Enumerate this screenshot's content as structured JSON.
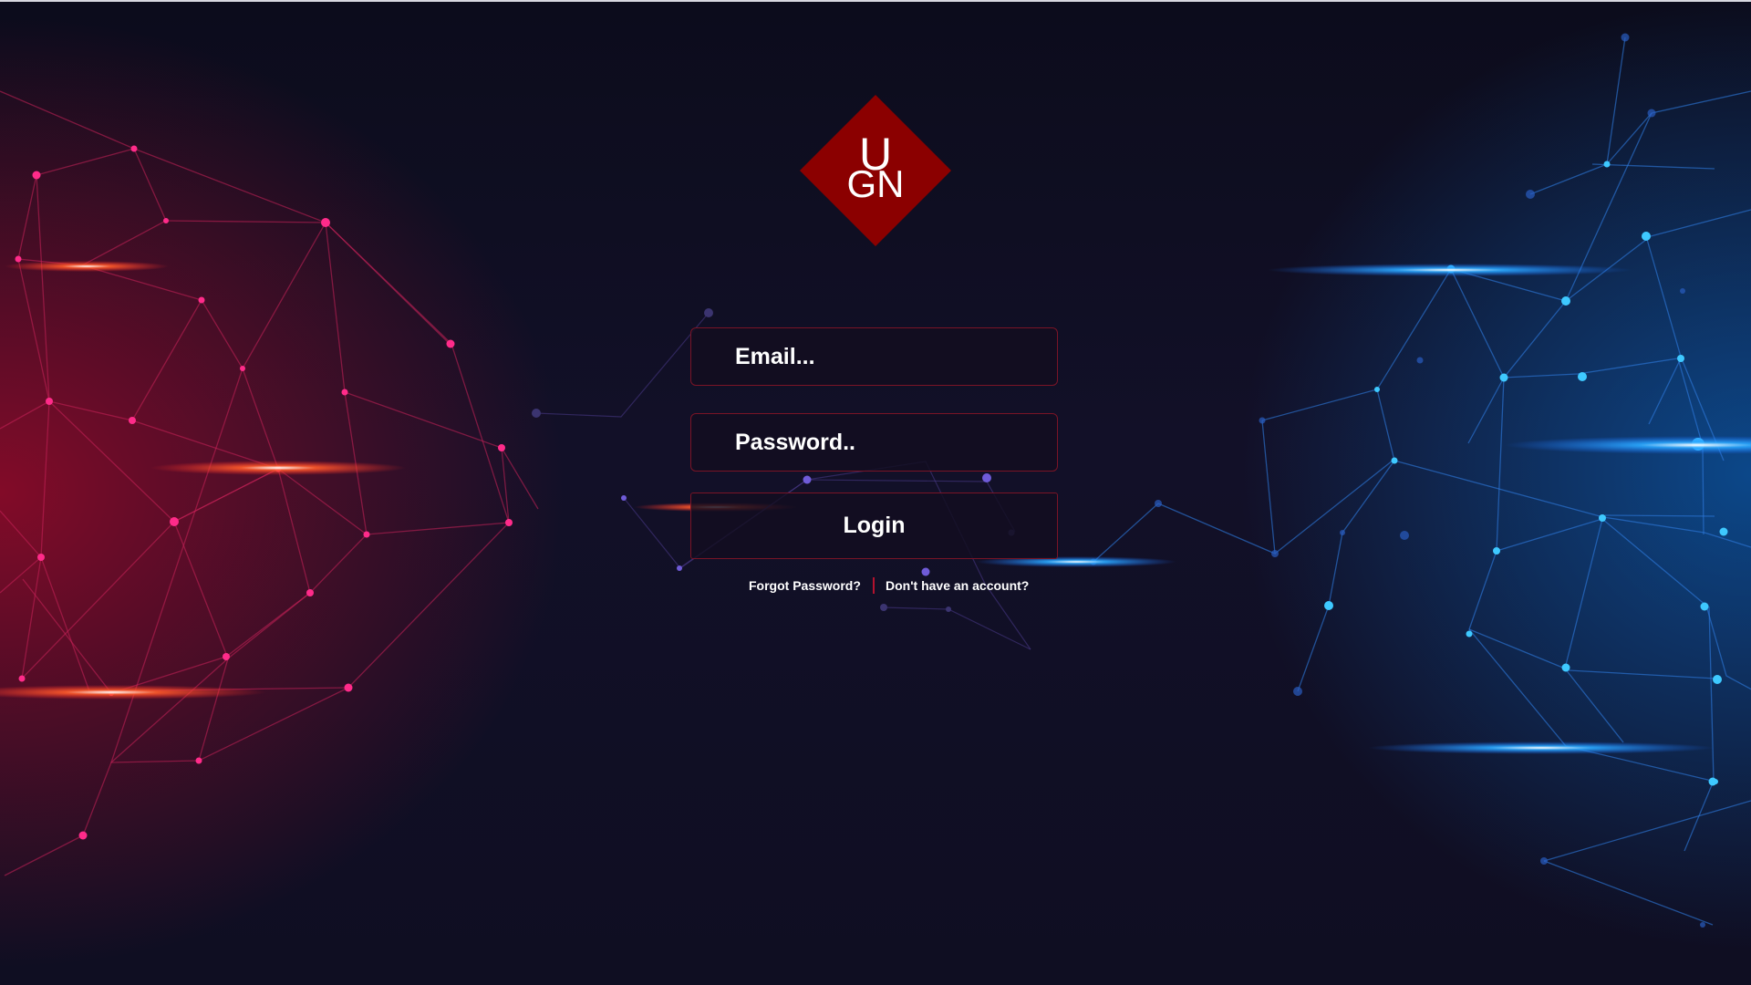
{
  "logo": {
    "line1": "U",
    "line2": "GN",
    "color": "#8b0000",
    "icon": "ugn-diamond-logo"
  },
  "login_form": {
    "email_placeholder": "Email...",
    "password_placeholder": "Password..",
    "login_label": "Login"
  },
  "links": {
    "forgot_password": "Forgot Password?",
    "no_account": "Don't have an account?"
  },
  "colors": {
    "accent": "#b3122e",
    "field_border": "#7a1426",
    "background": "#0d0d1f",
    "left_glow": "#d0103c",
    "right_glow": "#1a8cff"
  },
  "background_art": {
    "icon": "network-constellation-background"
  }
}
